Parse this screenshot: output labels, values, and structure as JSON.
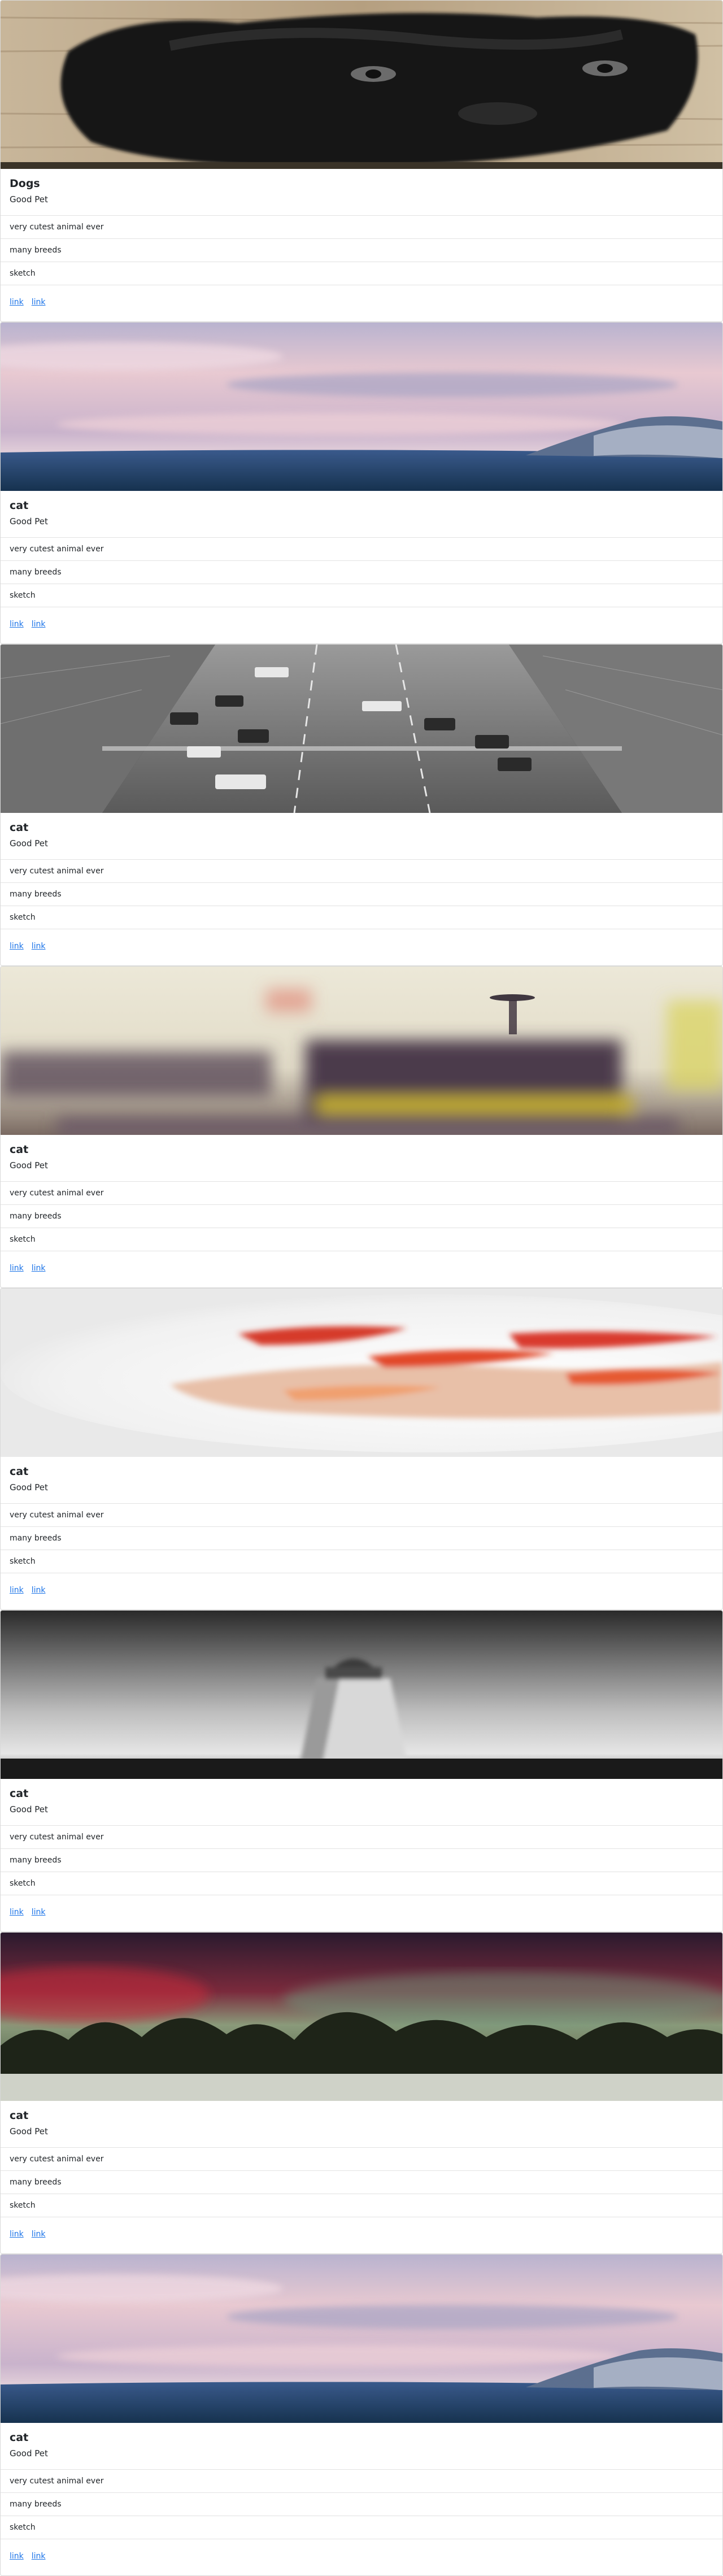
{
  "cards": [
    {
      "image": "dog-photo",
      "title": "Dogs",
      "text": "Good Pet",
      "items": [
        "very cutest animal ever",
        "many breeds",
        "sketch"
      ],
      "links": [
        "link",
        "link"
      ]
    },
    {
      "image": "sky-sea-photo",
      "title": "cat",
      "text": "Good Pet",
      "items": [
        "very cutest animal ever",
        "many breeds",
        "sketch"
      ],
      "links": [
        "link",
        "link"
      ]
    },
    {
      "image": "city-street-photo",
      "title": "cat",
      "text": "Good Pet",
      "items": [
        "very cutest animal ever",
        "many breeds",
        "sketch"
      ],
      "links": [
        "link",
        "link"
      ]
    },
    {
      "image": "cafe-blur-photo",
      "title": "cat",
      "text": "Good Pet",
      "items": [
        "very cutest animal ever",
        "many breeds",
        "sketch"
      ],
      "links": [
        "link",
        "link"
      ]
    },
    {
      "image": "food-plate-photo",
      "title": "cat",
      "text": "Good Pet",
      "items": [
        "very cutest animal ever",
        "many breeds",
        "sketch"
      ],
      "links": [
        "link",
        "link"
      ]
    },
    {
      "image": "lighthouse-photo",
      "title": "cat",
      "text": "Good Pet",
      "items": [
        "very cutest animal ever",
        "many breeds",
        "sketch"
      ],
      "links": [
        "link",
        "link"
      ]
    },
    {
      "image": "aurora-forest-photo",
      "title": "cat",
      "text": "Good Pet",
      "items": [
        "very cutest animal ever",
        "many breeds",
        "sketch"
      ],
      "links": [
        "link",
        "link"
      ]
    },
    {
      "image": "sky-sea-photo",
      "title": "cat",
      "text": "Good Pet",
      "items": [
        "very cutest animal ever",
        "many breeds",
        "sketch"
      ],
      "links": [
        "link",
        "link"
      ]
    }
  ]
}
